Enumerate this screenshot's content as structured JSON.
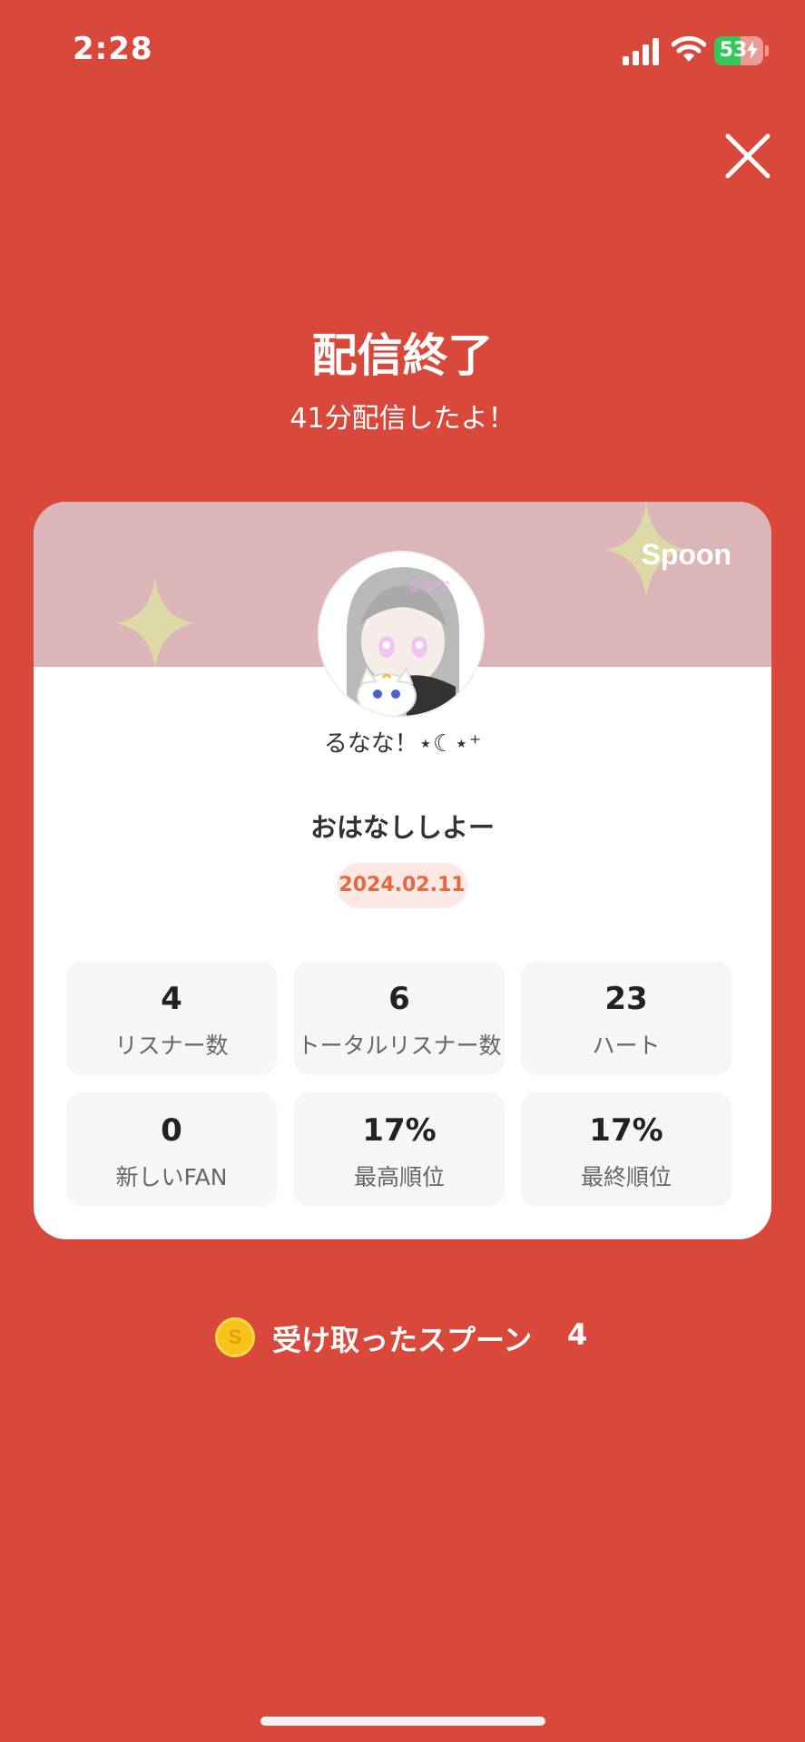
{
  "status_bar": {
    "time": "2:28",
    "battery_level": 53,
    "battery_text": "53",
    "icons": [
      "cellular-signal-icon",
      "wifi-icon",
      "battery-icon",
      "charging-bolt-icon"
    ]
  },
  "header": {
    "title": "配信終了",
    "subtitle": "41分配信したよ！",
    "close_icon": "close-icon"
  },
  "card": {
    "brand": "Spoon",
    "nickname": "るなな！⋆☾⋆⁺",
    "avatar_icon": "avatar-illustration",
    "stream_title": "おはなししよー",
    "date": "2024.02.11",
    "stats": [
      {
        "value": "4",
        "label": "リスナー数"
      },
      {
        "value": "6",
        "label": "トータルリスナー数"
      },
      {
        "value": "23",
        "label": "ハート"
      },
      {
        "value": "0",
        "label": "新しいFAN"
      },
      {
        "value": "17%",
        "label": "最高順位"
      },
      {
        "value": "17%",
        "label": "最終順位"
      }
    ]
  },
  "spoons": {
    "label": "受け取ったスプーン",
    "count": "4",
    "coin_letter": "S",
    "icon": "spoon-coin-icon"
  },
  "colors": {
    "background": "#d9493b",
    "banner": "#dcb5b8",
    "sparkle": "#dcd9a6",
    "date_badge_bg": "#fde8e3",
    "date_badge_text": "#e8673f"
  }
}
